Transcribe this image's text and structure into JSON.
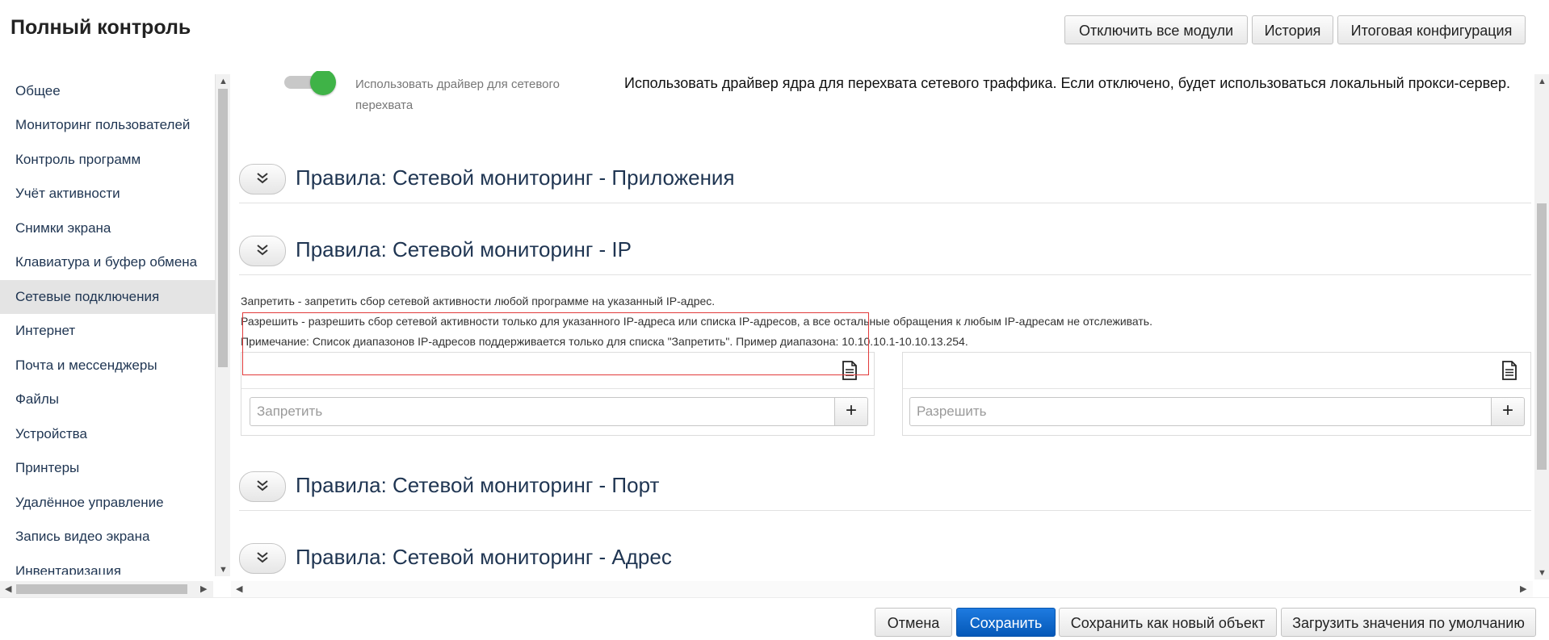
{
  "header": {
    "title": "Полный контроль",
    "buttons": {
      "disable_all": "Отключить все модули",
      "history": "История",
      "final_config": "Итоговая конфигурация"
    }
  },
  "sidebar": {
    "active_index": 6,
    "items": [
      {
        "label": "Общее"
      },
      {
        "label": "Мониторинг пользователей"
      },
      {
        "label": "Контроль программ"
      },
      {
        "label": "Учёт активности"
      },
      {
        "label": "Снимки экрана"
      },
      {
        "label": "Клавиатура и буфер обмена"
      },
      {
        "label": "Сетевые подключения"
      },
      {
        "label": "Интернет"
      },
      {
        "label": "Почта и мессенджеры"
      },
      {
        "label": "Файлы"
      },
      {
        "label": "Устройства"
      },
      {
        "label": "Принтеры"
      },
      {
        "label": "Удалённое управление"
      },
      {
        "label": "Запись видео экрана"
      },
      {
        "label": "Инвентаризация"
      }
    ]
  },
  "main": {
    "driver_toggle": {
      "state": "on",
      "label": "Использовать драйвер для сетевого перехвата",
      "description": "Использовать драйвер ядра для перехвата сетевого траффика. Если отключено, будет использоваться локальный прокси-сервер."
    },
    "sections": {
      "apps": "Правила: Сетевой мониторинг - Приложения",
      "ip": "Правила: Сетевой мониторинг - IP",
      "port": "Правила: Сетевой мониторинг - Порт",
      "address": "Правила: Сетевой мониторинг - Адрес"
    },
    "ip_info": {
      "deny": "Запретить - запретить сбор сетевой активности любой программе на указанный IP-адрес.",
      "allow": "Разрешить - разрешить сбор сетевой активности только для указанного IP-адреса или списка IP-адресов, а все остальные обращения к любым IP-адресам не отслеживать.",
      "note": "Примечание: Список диапазонов IP-адресов поддерживается только для списка \"Запретить\". Пример диапазона: 10.10.10.1-10.10.13.254."
    },
    "deny_input": {
      "placeholder": "Запретить",
      "value": ""
    },
    "allow_input": {
      "placeholder": "Разрешить",
      "value": ""
    },
    "add_symbol": "+"
  },
  "footer": {
    "cancel": "Отмена",
    "save": "Сохранить",
    "save_as_new": "Сохранить как новый объект",
    "load_defaults": "Загрузить значения по умолчанию"
  },
  "colors": {
    "accent_blue": "#0a6fd8",
    "toggle_on": "#3fb347",
    "highlight_red": "#e23b3b",
    "sidebar_active": "#e4e4e4",
    "heading_text": "#1f3552"
  }
}
